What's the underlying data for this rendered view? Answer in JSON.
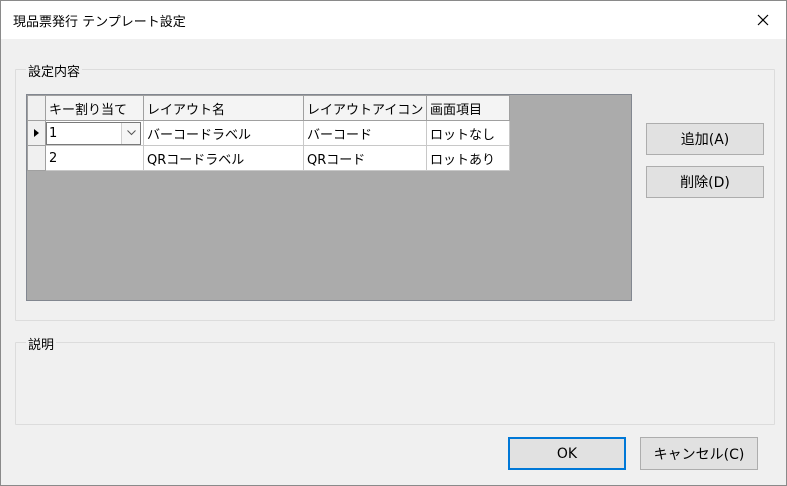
{
  "window": {
    "title": "現品票発行 テンプレート設定"
  },
  "settings_group": {
    "label": "設定内容"
  },
  "grid": {
    "columns": [
      "キー割り当て",
      "レイアウト名",
      "レイアウトアイコン",
      "画面項目"
    ],
    "rows": [
      {
        "key": "1",
        "layout_name": "バーコードラベル",
        "layout_icon": "バーコード",
        "screen_item": "ロットなし",
        "current": true
      },
      {
        "key": "2",
        "layout_name": "QRコードラベル",
        "layout_icon": "QRコード",
        "screen_item": "ロットあり",
        "current": false
      }
    ]
  },
  "buttons": {
    "add": "追加(A)",
    "delete": "削除(D)",
    "ok": "OK",
    "cancel": "キャンセル(C)"
  },
  "description_group": {
    "label": "説明"
  },
  "icons": {
    "close": "close-icon",
    "dropdown": "chevron-down-icon",
    "row_indicator": "current-row-arrow-icon"
  },
  "colors": {
    "accent": "#0078d7",
    "grid_background": "#ababab"
  }
}
